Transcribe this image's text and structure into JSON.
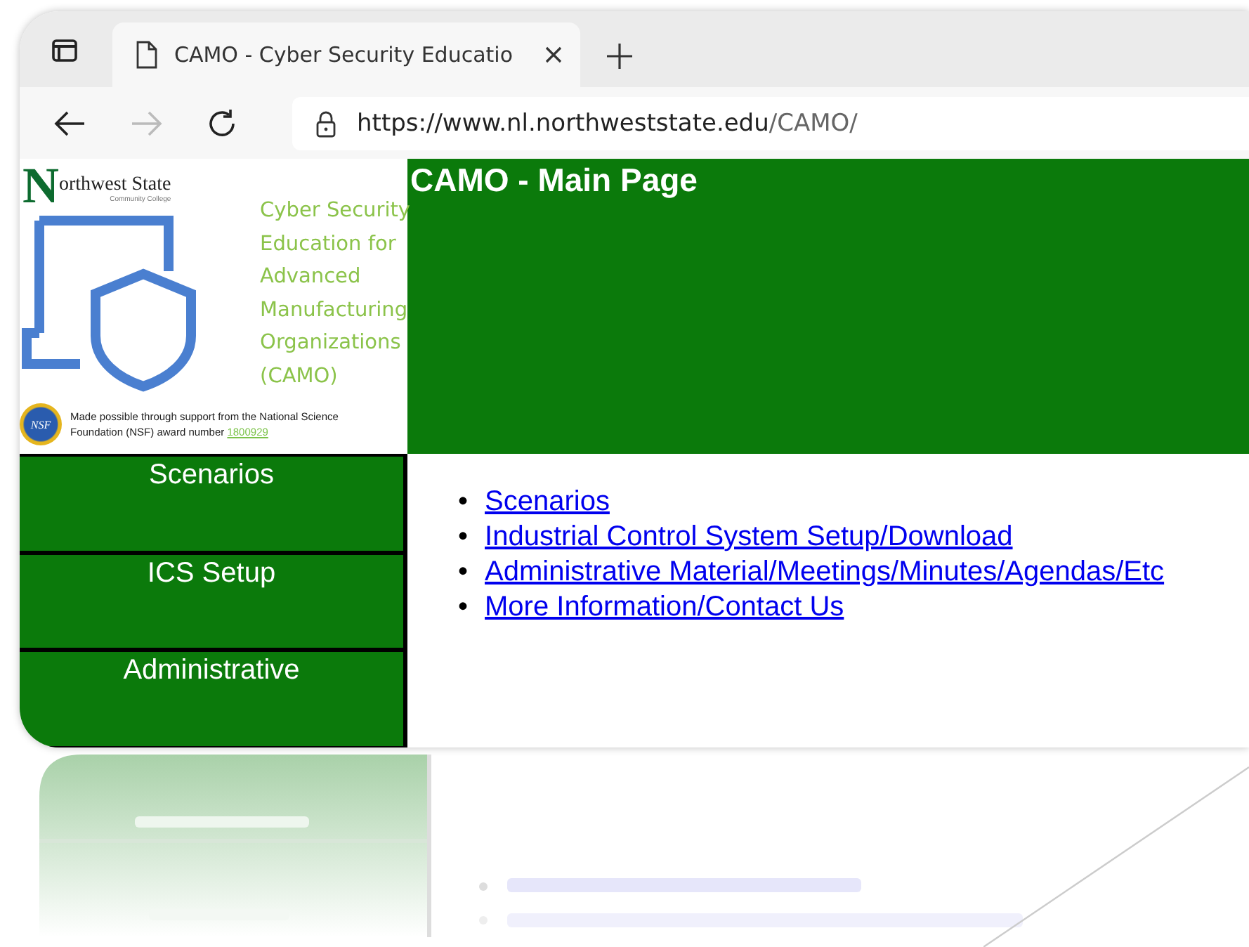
{
  "browser": {
    "tabs": [
      {
        "title": "CAMO - Cyber Security Educatio",
        "selected": true
      }
    ],
    "address_host": "https://www.nl.northweststate.edu",
    "address_path": "/CAMO/"
  },
  "logo": {
    "initial": "N",
    "college": "orthwest State",
    "college_subtitle": "Community College",
    "title_lines": [
      "Cyber Security",
      "Education for",
      "Advanced",
      "Manufacturing",
      "Organizations",
      "(CAMO)"
    ],
    "badge": "NSF",
    "credit": "Made possible through support from the National Science Foundation (NSF) award number",
    "award": "1800929"
  },
  "header": {
    "title": "CAMO - Main Page"
  },
  "nav": [
    {
      "label": "Scenarios"
    },
    {
      "label": "ICS Setup"
    },
    {
      "label": "Administrative"
    }
  ],
  "links": [
    {
      "marker": "•",
      "text": "Scenarios"
    },
    {
      "marker": "•",
      "text": "Industrial Control System Setup/Download"
    },
    {
      "marker": "•",
      "text": "Administrative Material/Meetings/Minutes/Agendas/Etc"
    },
    {
      "marker": "•",
      "text": "More Information/Contact Us"
    }
  ]
}
